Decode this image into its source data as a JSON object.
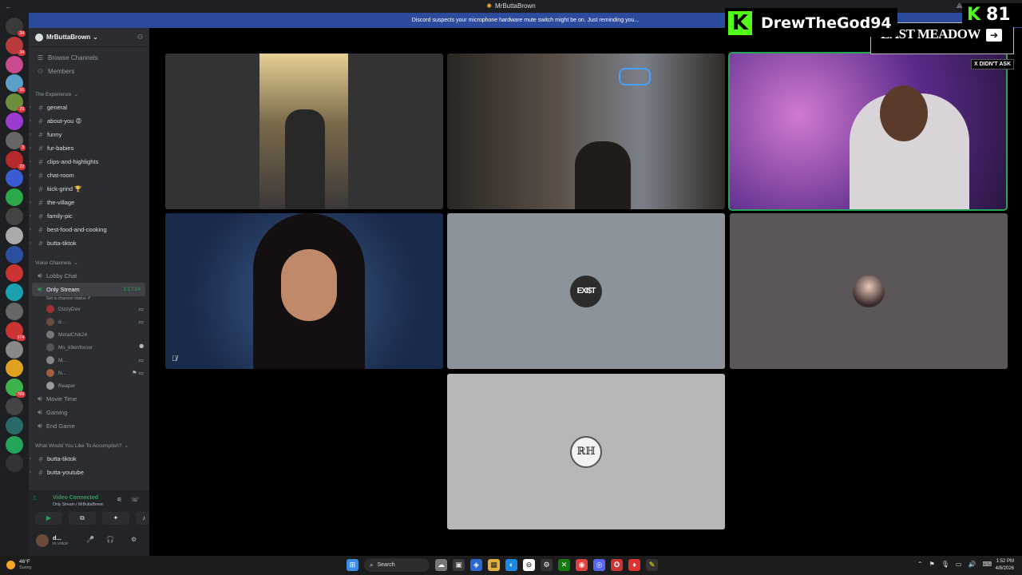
{
  "window": {
    "title": "MrButtaBrown",
    "back_glyph": "←",
    "ctrl_1": "⟁",
    "ctrl_2": "▭",
    "ctrl_3": "–",
    "ctrl_4": "□",
    "ctrl_5": "✕"
  },
  "banner": {
    "text": "Discord suspects your microphone hardware mute switch might be on. Just reminding you..."
  },
  "guilds": [
    {
      "color": "#3a3a3a",
      "badge": "34"
    },
    {
      "color": "#b83a3a",
      "badge": "34"
    },
    {
      "color": "#c94b8f",
      "badge": ""
    },
    {
      "color": "#5aa0c8",
      "badge": "56"
    },
    {
      "color": "#6d8f3c",
      "badge": "29"
    },
    {
      "color": "#9b3bd1",
      "badge": ""
    },
    {
      "color": "#666",
      "badge": "3"
    },
    {
      "color": "#b52a2a",
      "badge": "22"
    },
    {
      "color": "#3b5bd1",
      "badge": ""
    },
    {
      "color": "#2aa84a",
      "badge": ""
    },
    {
      "color": "#444",
      "badge": ""
    },
    {
      "color": "#aaa",
      "badge": ""
    },
    {
      "color": "#2c4fa0",
      "badge": ""
    },
    {
      "color": "#c33",
      "badge": ""
    },
    {
      "color": "#1aa0b0",
      "badge": ""
    },
    {
      "color": "#666",
      "badge": ""
    },
    {
      "color": "#c33",
      "badge": "174"
    },
    {
      "color": "#888",
      "badge": ""
    },
    {
      "color": "#e0a020",
      "badge": ""
    },
    {
      "color": "#3bb34a",
      "badge": "789"
    },
    {
      "color": "#444",
      "badge": ""
    },
    {
      "color": "#2a6a6a",
      "badge": ""
    },
    {
      "color": "#23a55a",
      "badge": ""
    },
    {
      "color": "#313338",
      "badge": ""
    }
  ],
  "sidebar": {
    "server_name": "MrButtaBrown",
    "server_chevron": "⌄",
    "add_member_glyph": "⚇",
    "browse": "Browse Channels",
    "members": "Members",
    "cat1": "The Experience",
    "text_channels": [
      {
        "name": "general",
        "icon": "#",
        "arrow": "›"
      },
      {
        "name": "about-you 😡",
        "icon": "#",
        "arrow": "›"
      },
      {
        "name": "funny",
        "icon": "#",
        "arrow": "›"
      },
      {
        "name": "fur-babies",
        "icon": "#",
        "arrow": "›"
      },
      {
        "name": "clips-and-highlights",
        "icon": "#",
        "arrow": "›"
      },
      {
        "name": "chat-room",
        "icon": "#",
        "arrow": "›"
      },
      {
        "name": "kick-grind 🏆",
        "icon": "#",
        "arrow": "›"
      },
      {
        "name": "the-village",
        "icon": "#",
        "arrow": "›"
      },
      {
        "name": "family-pic",
        "icon": "#",
        "arrow": "›"
      },
      {
        "name": "best-food-and-cooking",
        "icon": "#",
        "arrow": "›"
      },
      {
        "name": "butta-tiktok",
        "icon": "#",
        "arrow": "›"
      }
    ],
    "cat2": "Voice Channels",
    "lobby": "Lobby Chat",
    "only_stream": "Only Stream",
    "only_stream_time": "1:17:24",
    "only_stream_status": "Set a channel status ✐",
    "voice_users": [
      {
        "name": "DizzyDev",
        "color": "#a03030",
        "icon": "▭"
      },
      {
        "name": "d...",
        "color": "#6b4b3a",
        "icon": "▭"
      },
      {
        "name": "MetalChik24",
        "color": "#777",
        "icon": ""
      },
      {
        "name": "Ms_k9enforcer",
        "color": "#555",
        "icon": "⯄"
      },
      {
        "name": "M...",
        "color": "#888",
        "icon": "▭"
      },
      {
        "name": "N...",
        "color": "#a06040",
        "icon": "⚑ ▭"
      },
      {
        "name": "Reaper",
        "color": "#999",
        "icon": ""
      }
    ],
    "more_voice": [
      "Movie Time",
      "Gaming",
      "End Game"
    ],
    "cat3": "What Would You Like To Accomplish?",
    "bottom_channels": [
      "butta-tiktok",
      "butta-youtube"
    ]
  },
  "voice_panel": {
    "status": "Video Connected",
    "sub": "Only Stream / MrButtaBrown",
    "signal_glyph": "⎍",
    "noise_glyph": "⚟",
    "leave_glyph": "☏",
    "btn_video": "▶",
    "btn_share": "⧉",
    "btn_activity": "✦",
    "btn_soundboard": "♪"
  },
  "user_panel": {
    "name": "d...",
    "status": "In voice",
    "mic": "🎤",
    "headset": "🎧",
    "settings": "⚙"
  },
  "overlays": {
    "kick_letter": "K",
    "kick_name": "DrewTheGod94",
    "meadow": "EAST MEADOW",
    "meadow_arrow": "➔",
    "kick_count_letter": "K",
    "kick_count": "81",
    "didnt_ask": "X DIDN'T ASK"
  },
  "tiles": [
    {
      "id": "t1",
      "bg": "#333",
      "mute": ""
    },
    {
      "id": "t2",
      "bg": "#3a3430",
      "mute": ""
    },
    {
      "id": "t3",
      "bg": "#4a2a6a",
      "mute": ""
    },
    {
      "id": "t4",
      "bg": "#2a3c5a",
      "mute": "🎙̸"
    },
    {
      "id": "t5",
      "bg": "#8d939a",
      "avatar_text": "EXI$T"
    },
    {
      "id": "t6",
      "bg": "#5b5759",
      "mute": ""
    },
    {
      "id": "t7",
      "bg": "#b7b7b7",
      "avatar_text": "ℝℍ"
    }
  ],
  "taskbar": {
    "temp": "46°F",
    "cond": "Sunny",
    "search": "Search",
    "search_glyph": "⌕",
    "time": "1:52 PM",
    "date": "4/8/2026",
    "tray_1": "⌃",
    "tray_2": "⚑",
    "tray_3": "🎙",
    "tray_4": "▭",
    "tray_5": "🔊",
    "tray_6": "⌨",
    "apps": [
      {
        "glyph": "⊞",
        "color": "#3a8ee6",
        "fg": "#fff"
      },
      {
        "glyph": "",
        "color": "#555",
        "fg": "#fff",
        "is_search": true
      },
      {
        "glyph": "☁",
        "color": "#777",
        "fg": "#fff"
      },
      {
        "glyph": "▣",
        "color": "#3a3a3a",
        "fg": "#ddd"
      },
      {
        "glyph": "◈",
        "color": "#2a6ad0",
        "fg": "#fff"
      },
      {
        "glyph": "▦",
        "color": "#e0b040",
        "fg": "#222"
      },
      {
        "glyph": "◐",
        "color": "#1e88e5",
        "fg": "#fff"
      },
      {
        "glyph": "⊖",
        "color": "#fff",
        "fg": "#000"
      },
      {
        "glyph": "⚙",
        "color": "#333",
        "fg": "#fff"
      },
      {
        "glyph": "✕",
        "color": "#107c10",
        "fg": "#fff"
      },
      {
        "glyph": "◉",
        "color": "#e04040",
        "fg": "#fff"
      },
      {
        "glyph": "◎",
        "color": "#5865f2",
        "fg": "#fff"
      },
      {
        "glyph": "✪",
        "color": "#c33",
        "fg": "#fff"
      },
      {
        "glyph": "♦",
        "color": "#d33",
        "fg": "#fff"
      },
      {
        "glyph": "✎",
        "color": "#333",
        "fg": "#ff0"
      }
    ]
  }
}
